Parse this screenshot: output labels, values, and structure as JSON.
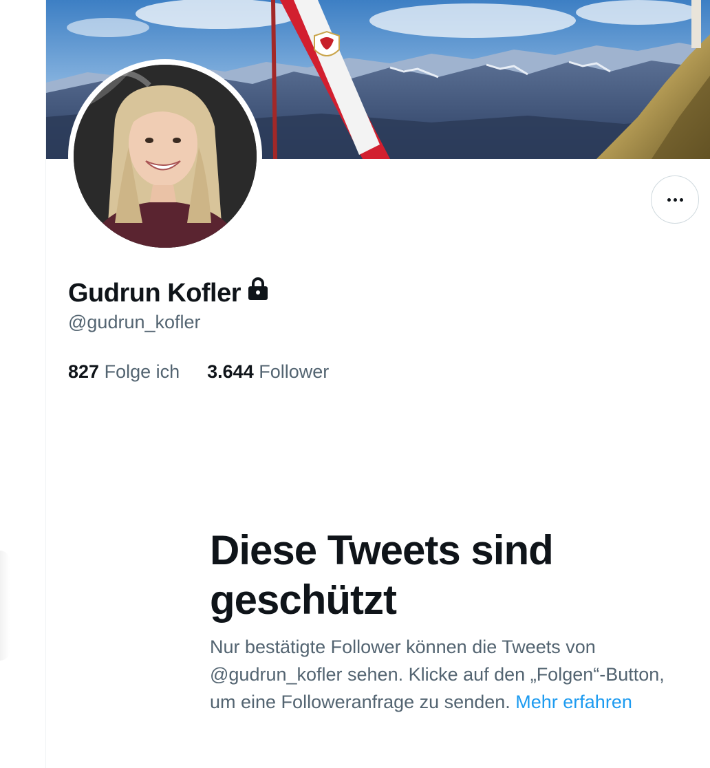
{
  "profile": {
    "display_name": "Gudrun Kofler",
    "handle": "@gudrun_kofler",
    "following_count": "827",
    "following_label": "Folge ich",
    "followers_count": "3.644",
    "followers_label": "Follower",
    "protected_icon": "lock-icon",
    "more_icon": "more-dots-icon"
  },
  "protected_notice": {
    "title": "Diese Tweets sind geschützt",
    "body_prefix": "Nur bestätigte Follower können die Tweets von @gudrun_kofler sehen. Klicke auf den „Folgen“-Button, um eine Followeranfrage zu senden. ",
    "link_text": "Mehr erfahren"
  },
  "colors": {
    "text_primary": "#0f1419",
    "text_secondary": "#536471",
    "link": "#1d9bf0",
    "border": "#cfd9de"
  }
}
